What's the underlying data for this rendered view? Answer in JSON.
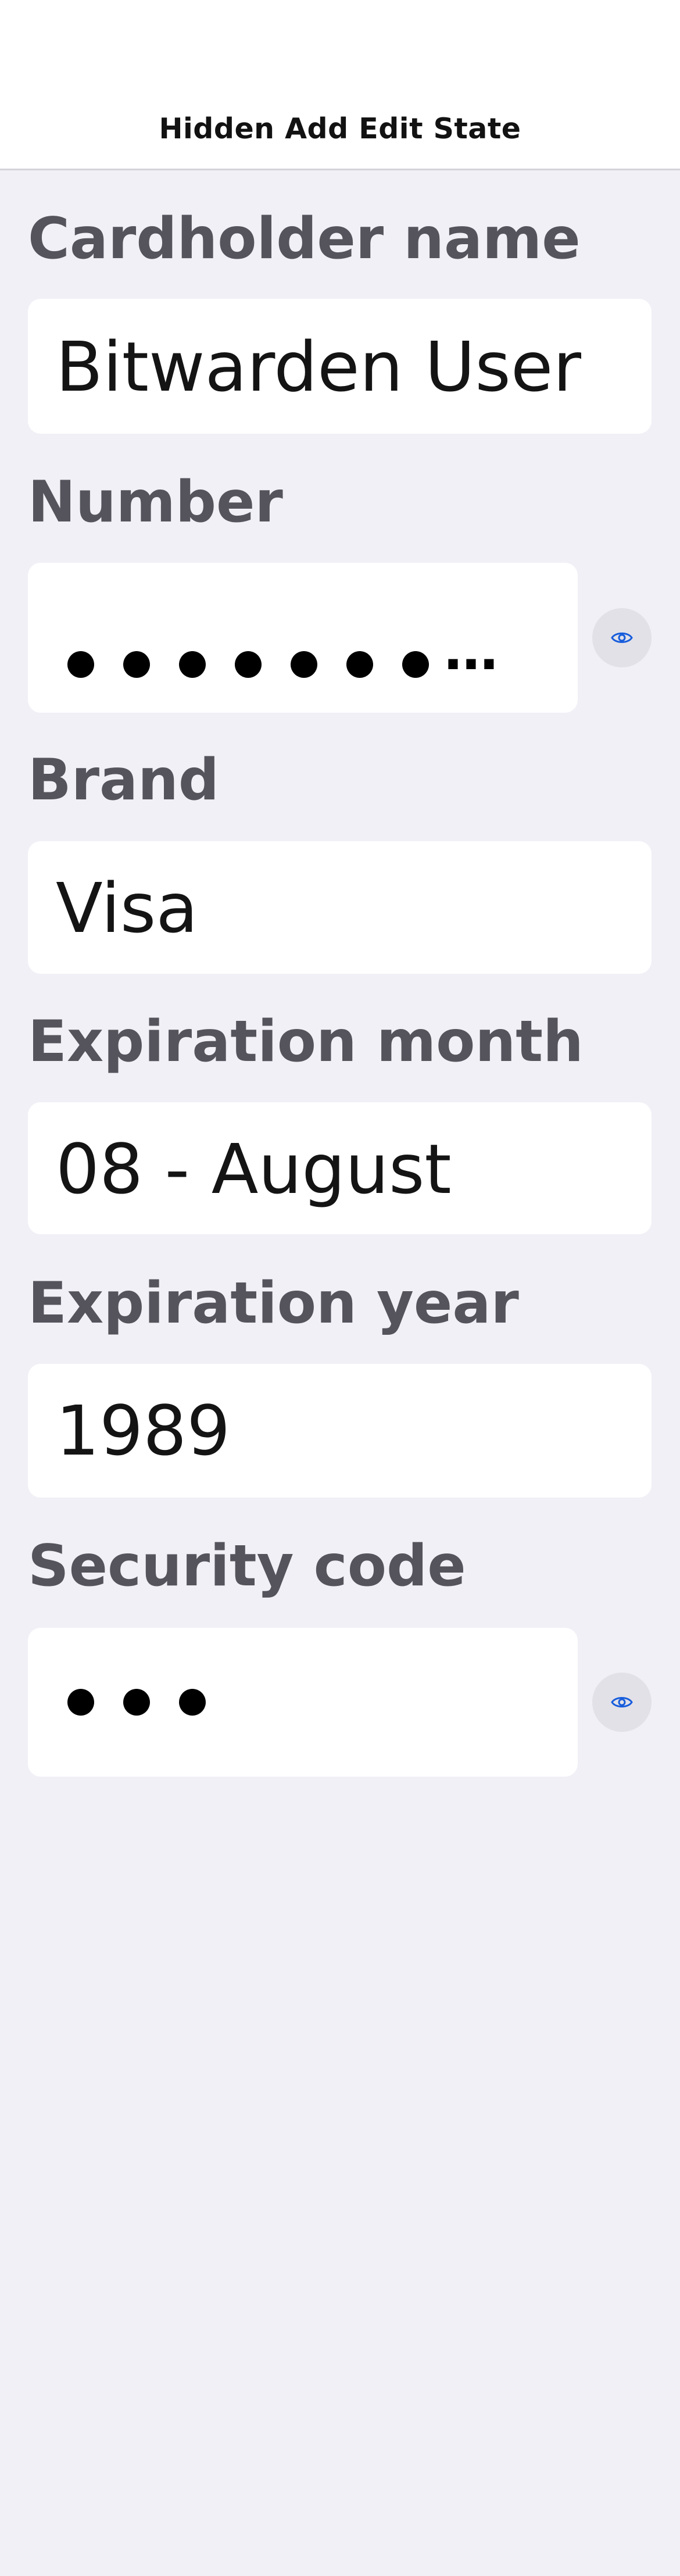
{
  "nav": {
    "title": "Hidden Add Edit State"
  },
  "colors": {
    "background": "#f1f0f6",
    "field_background": "#ffffff",
    "label": "#55545c",
    "value": "#141414",
    "accent": "#175ddc",
    "eye_button_background": "#e2e1e8"
  },
  "fields": {
    "cardholder_name": {
      "label": "Cardholder name",
      "value": "Bitwarden User"
    },
    "number": {
      "label": "Number",
      "masked": true,
      "visible_dot_count": 7,
      "overflow": "...",
      "toggle_icon": "eye-icon"
    },
    "brand": {
      "label": "Brand",
      "value": "Visa"
    },
    "expiration_month": {
      "label": "Expiration month",
      "value": "08 - August"
    },
    "expiration_year": {
      "label": "Expiration year",
      "value": "1989"
    },
    "security_code": {
      "label": "Security code",
      "masked": true,
      "visible_dot_count": 3,
      "toggle_icon": "eye-icon"
    }
  }
}
